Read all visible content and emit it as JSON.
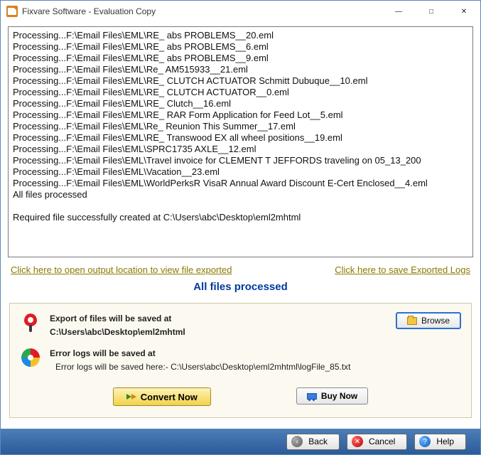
{
  "window": {
    "title": "Fixvare Software - Evaluation Copy"
  },
  "log": {
    "lines": [
      "Processing...F:\\Email Files\\EML\\RE_ abs PROBLEMS__20.eml",
      "Processing...F:\\Email Files\\EML\\RE_ abs PROBLEMS__6.eml",
      "Processing...F:\\Email Files\\EML\\RE_ abs PROBLEMS__9.eml",
      "Processing...F:\\Email Files\\EML\\Re_ AM515933__21.eml",
      "Processing...F:\\Email Files\\EML\\RE_ CLUTCH ACTUATOR Schmitt Dubuque__10.eml",
      "Processing...F:\\Email Files\\EML\\RE_ CLUTCH ACTUATOR__0.eml",
      "Processing...F:\\Email Files\\EML\\RE_ Clutch__16.eml",
      "Processing...F:\\Email Files\\EML\\RE_ RAR Form Application for Feed Lot__5.eml",
      "Processing...F:\\Email Files\\EML\\Re_ Reunion This Summer__17.eml",
      "Processing...F:\\Email Files\\EML\\RE_ Transwood EX all wheel positions__19.eml",
      "Processing...F:\\Email Files\\EML\\SPRC1735 AXLE__12.eml",
      "Processing...F:\\Email Files\\EML\\Travel invoice for CLEMENT T JEFFORDS traveling on 05_13_200",
      "Processing...F:\\Email Files\\EML\\Vacation__23.eml",
      "Processing...F:\\Email Files\\EML\\WorldPerksR VisaR Annual Award Discount E-Cert Enclosed__4.eml",
      "All files processed",
      "",
      "Required file successfully created at C:\\Users\\abc\\Desktop\\eml2mhtml"
    ]
  },
  "links": {
    "open_output": "Click here to open output location to view file exported",
    "save_logs": "Click here to save Exported Logs"
  },
  "status": "All files processed",
  "export": {
    "label": "Export of files will be saved at",
    "path": "C:\\Users\\abc\\Desktop\\eml2mhtml",
    "browse": "Browse"
  },
  "errors": {
    "label": "Error logs will be saved at",
    "path": "Error logs will be saved here:- C:\\Users\\abc\\Desktop\\eml2mhtml\\logFile_85.txt"
  },
  "actions": {
    "convert": "Convert Now",
    "buy": "Buy Now"
  },
  "footer": {
    "back": "Back",
    "cancel": "Cancel",
    "help": "Help"
  }
}
